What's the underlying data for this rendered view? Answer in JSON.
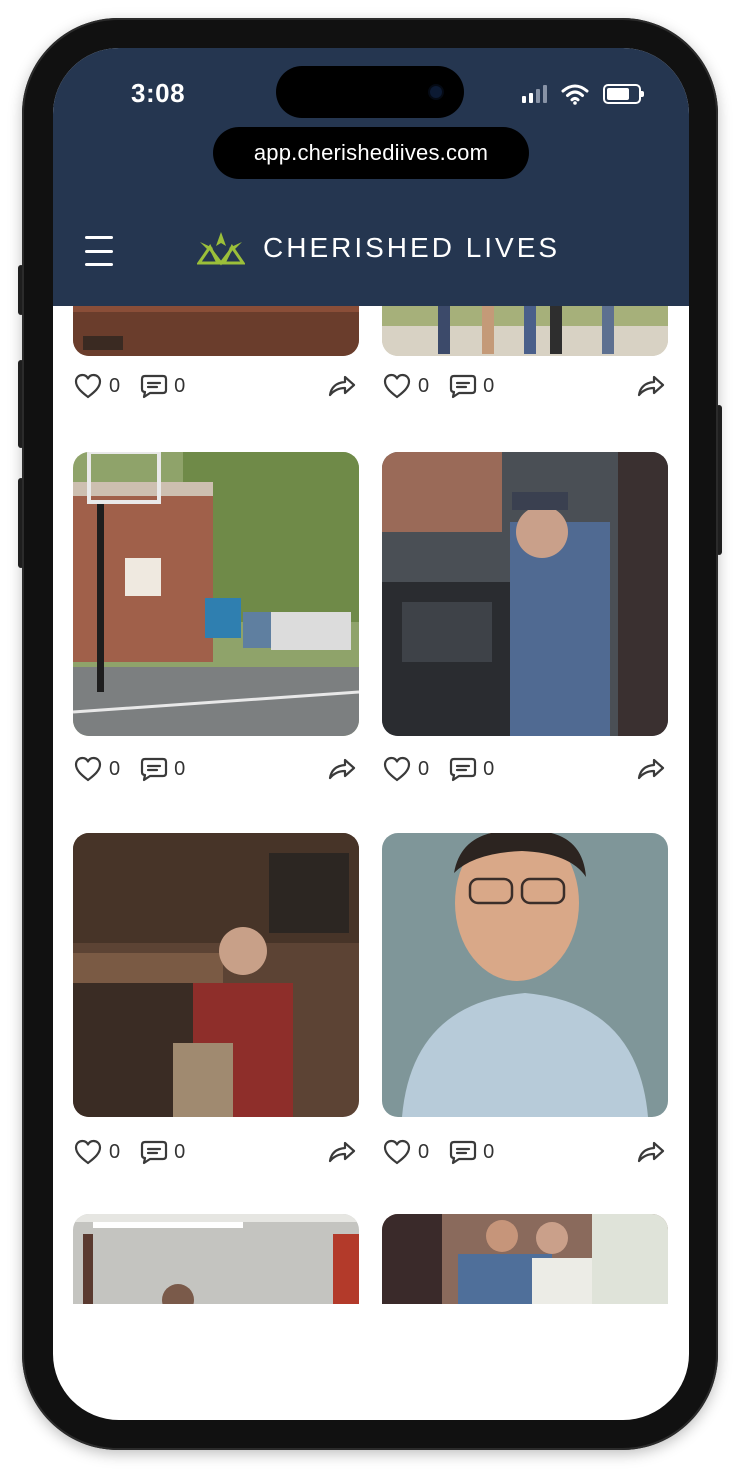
{
  "status_bar": {
    "time": "3:08"
  },
  "browser": {
    "url": "app.cherishediives.com"
  },
  "app": {
    "brand_name": "CHERISHED LIVES",
    "colors": {
      "header": "#253650",
      "logo": "#9bbf3a"
    }
  },
  "posts": [
    {
      "likes": "0",
      "comments": "0"
    },
    {
      "likes": "0",
      "comments": "0"
    },
    {
      "likes": "0",
      "comments": "0"
    },
    {
      "likes": "0",
      "comments": "0"
    },
    {
      "likes": "0",
      "comments": "0"
    },
    {
      "likes": "0",
      "comments": "0"
    }
  ]
}
